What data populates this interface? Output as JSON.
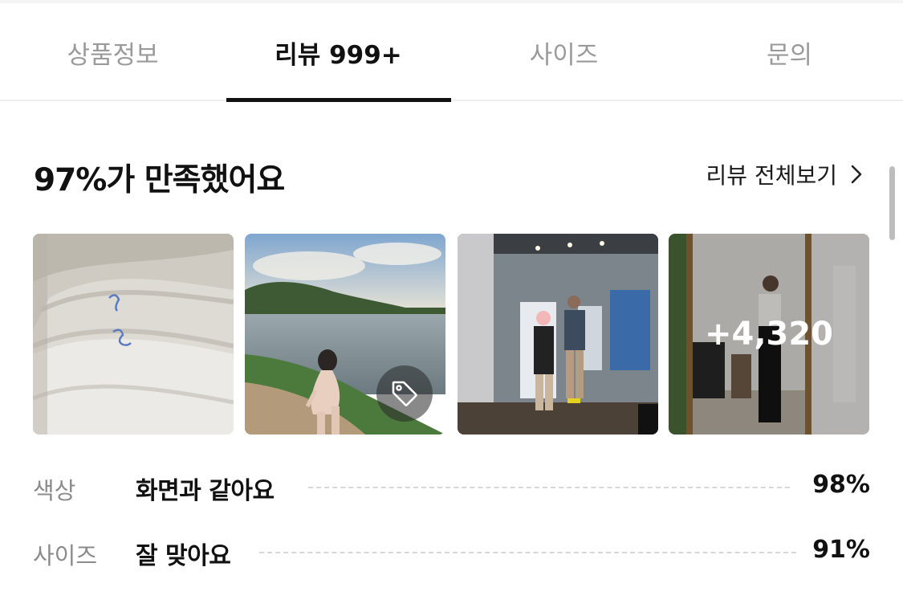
{
  "tabs": [
    {
      "label": "상품정보",
      "active": false
    },
    {
      "label": "리뷰 999+",
      "active": true
    },
    {
      "label": "사이즈",
      "active": false
    },
    {
      "label": "문의",
      "active": false
    }
  ],
  "summary": {
    "title": "97%가 만족했어요",
    "see_all_label": "리뷰 전체보기"
  },
  "photos": {
    "items": [
      {
        "icon": "none"
      },
      {
        "icon": "tag-icon"
      },
      {
        "icon": "none"
      },
      {
        "icon": "none"
      }
    ],
    "more_count": "+4,320"
  },
  "stats": [
    {
      "label": "색상",
      "value": "화면과 같아요",
      "percent": "98%"
    },
    {
      "label": "사이즈",
      "value": "잘 맞아요",
      "percent": "91%"
    }
  ],
  "colors": {
    "text_primary": "#111111",
    "text_secondary": "#9a9a9a",
    "active_underline": "#111111"
  }
}
